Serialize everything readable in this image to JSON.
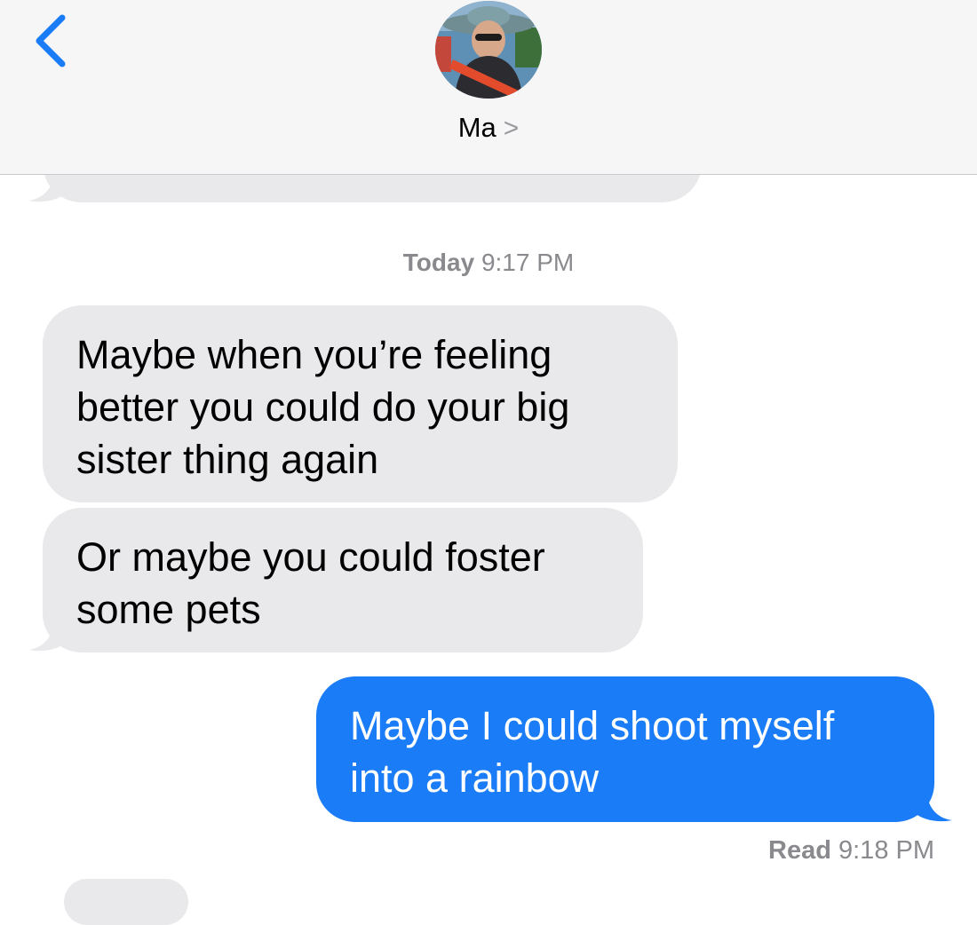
{
  "header": {
    "contact_name": "Ma",
    "contact_chevron": ">",
    "back_icon": "chevron-left-icon",
    "accent_color": "#1a7cf7"
  },
  "conversation": {
    "timestamp_day": "Today",
    "timestamp_time": "9:17 PM",
    "messages": [
      {
        "direction": "incoming",
        "text": "Maybe when you’re feeling better you could do your big sister thing again"
      },
      {
        "direction": "incoming",
        "text": "Or maybe you could foster some pets"
      },
      {
        "direction": "outgoing",
        "text": "Maybe I could shoot myself into a rainbow"
      }
    ],
    "receipt_label": "Read",
    "receipt_time": "9:18 PM"
  },
  "colors": {
    "incoming_bubble": "#e9e9eb",
    "outgoing_bubble": "#1a7cf7",
    "meta_text": "#8a8a8e"
  }
}
